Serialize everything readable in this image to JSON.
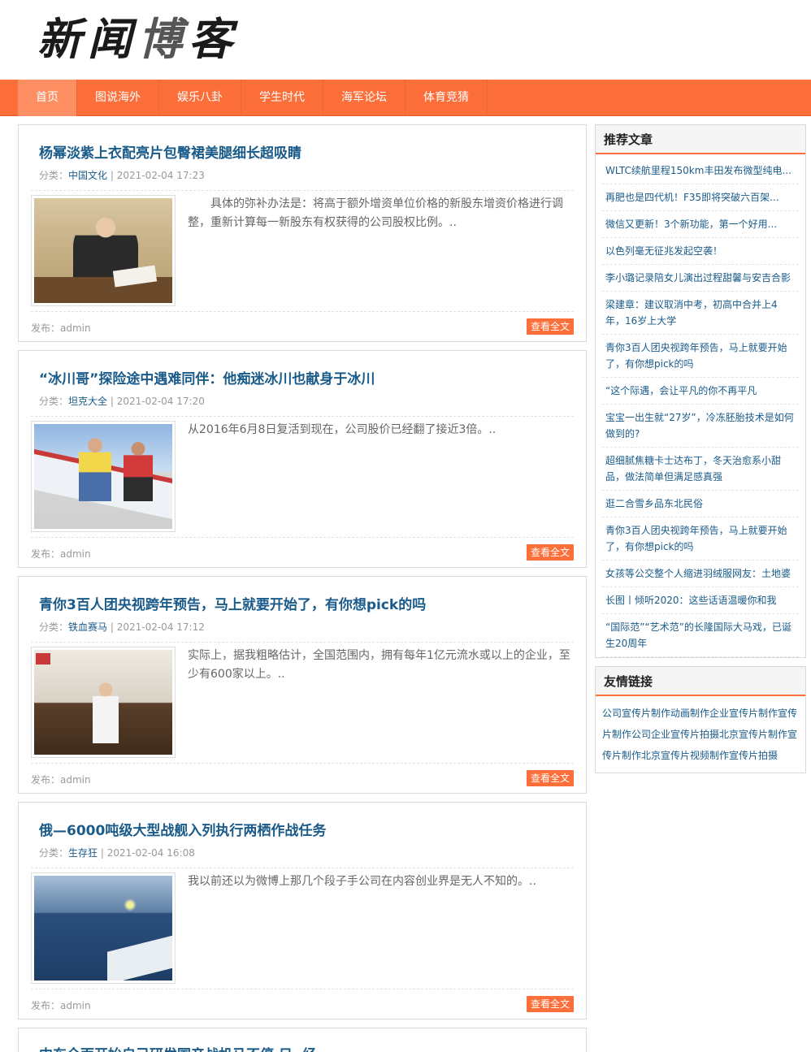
{
  "site": {
    "logo_text": [
      "新",
      "闻",
      "博",
      "客"
    ]
  },
  "nav": {
    "items": [
      {
        "label": "首页",
        "active": true
      },
      {
        "label": "图说海外",
        "active": false
      },
      {
        "label": "娱乐八卦",
        "active": false
      },
      {
        "label": "学生时代",
        "active": false
      },
      {
        "label": "海军论坛",
        "active": false
      },
      {
        "label": "体育竞猜",
        "active": false
      }
    ]
  },
  "labels": {
    "category_prefix": "分类：",
    "author_prefix": "发布：",
    "read_more": "查看全文",
    "sep": " | "
  },
  "posts": [
    {
      "title": "杨幂淡紫上衣配亮片包臀裙美腿细长超吸睛",
      "category": "中国文化",
      "date": "2021-02-04 17:23",
      "summary": "　　具体的弥补办法是：将高于额外增资单位价格的新股东增资价格进行调整，重新计算每一新股东有权获得的公司股权比例。..",
      "author": "admin",
      "image_icon": "news-photo"
    },
    {
      "title": "“冰川哥”探险途中遇难同伴：他痴迷冰川也献身于冰川",
      "category": "坦克大全",
      "date": "2021-02-04 17:20",
      "summary": "从2016年6月8日复活到现在，公司股价已经翻了接近3倍。..",
      "author": "admin",
      "image_icon": "news-photo"
    },
    {
      "title": "青你3百人团央视跨年预告，马上就要开始了，有你想pick的吗",
      "category": "铁血赛马",
      "date": "2021-02-04 17:12",
      "summary": "实际上，据我粗略估计，全国范围内，拥有每年1亿元流水或以上的企业，至少有600家以上。..",
      "author": "admin",
      "image_icon": "news-photo"
    },
    {
      "title": "俄—6000吨级大型战舰入列执行两栖作战任务",
      "category": "生存狂",
      "date": "2021-02-04 16:08",
      "summary": "我以前还以为微博上那几个段子手公司在内容创业界是无人不知的。..",
      "author": "admin",
      "image_icon": "news-photo"
    }
  ],
  "sidebar": {
    "recommended_title": "推荐文章",
    "recommended": [
      "WLTC续航里程150km丰田发布微型纯电...",
      "再肥也是四代机！F35即将突破六百架...",
      "微信又更新！3个新功能，第一个好用...",
      "以色列毫无征兆发起空袭！",
      "李小璐记录陪女儿演出过程甜馨与安吉合影",
      "梁建章：建议取消中考，初高中合并上4年，16岁上大学",
      "青你3百人团央视跨年预告，马上就要开始了，有你想pick的吗",
      "“这个际遇，会让平凡的你不再平凡",
      "宝宝一出生就“27岁”，冷冻胚胎技术是如何做到的?",
      "超细腻焦糖卡士达布丁，冬天治愈系小甜品，做法简单但满足感真强",
      "逛二合雪乡品东北民俗",
      "青你3百人团央视跨年预告，马上就要开始了，有你想pick的吗",
      "女孩等公交整个人缩进羽绒服网友：土地婆",
      "长图丨倾听2020：这些话语温暖你和我",
      "“国际范”“艺术范”的长隆国际大马戏，已诞生20周年"
    ],
    "links_title": "友情链接",
    "links": [
      "公司宣传片制作",
      "动画制作",
      "企业宣传片制作",
      "宣传片制作",
      "公司企业宣传片拍摄",
      "北京宣传片制作",
      "宣传片制作",
      "北京宣传片",
      "视频制作",
      "宣传片拍摄"
    ]
  },
  "partial_title": "中东全面开始自己研发国产战机马不停 日.  经"
}
